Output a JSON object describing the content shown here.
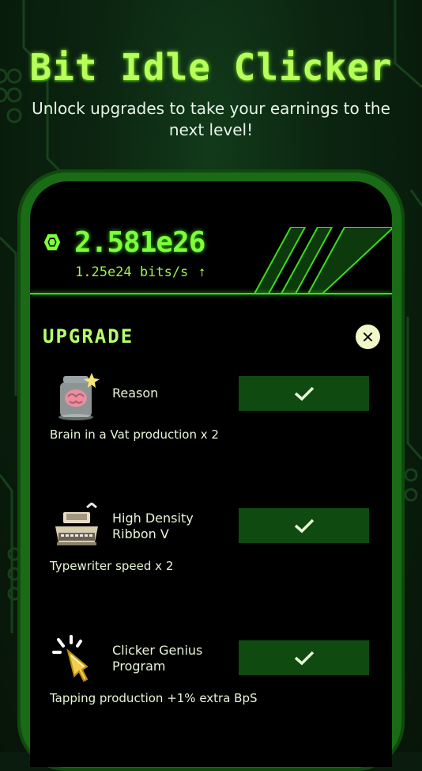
{
  "header": {
    "title": "Bit Idle Clicker",
    "subtitle": "Unlock upgrades to take your earnings to the next level!"
  },
  "stats": {
    "total": "2.581e26",
    "rate": "1.25e24 bits/s"
  },
  "panel": {
    "title": "UPGRADE"
  },
  "upgrades": [
    {
      "name": "Reason",
      "description": "Brain in a Vat production x 2",
      "icon": "brain-jar-icon"
    },
    {
      "name": "High Density Ribbon V",
      "description": "Typewriter speed x 2",
      "icon": "typewriter-icon"
    },
    {
      "name": "Clicker Genius Program",
      "description": "Tapping production +1% extra BpS",
      "icon": "tapping-hand-icon"
    }
  ],
  "colors": {
    "accent": "#7dff3a",
    "button": "#0f4a10",
    "frame": "#1a6b16"
  }
}
